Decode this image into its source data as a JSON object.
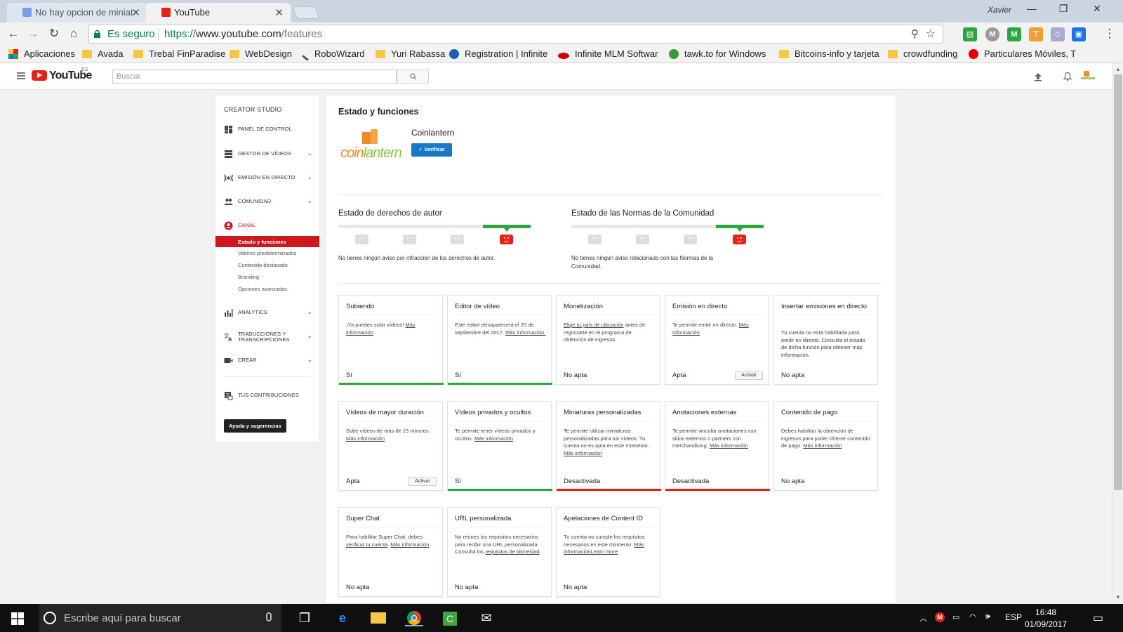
{
  "browser": {
    "tabs": [
      {
        "title": "No hay opcion de miniat",
        "active": false
      },
      {
        "title": "YouTube",
        "active": true
      }
    ],
    "user": "Xavier",
    "secure_label": "Es seguro",
    "url_proto": "https://",
    "url_host": "www.youtube.com",
    "url_path": "/features",
    "bookmarks": [
      "Aplicaciones",
      "Avada",
      "Trebal FinParadise",
      "WebDesign",
      "RoboWizard",
      "Yuri Rabassa",
      "Registration | Infinite",
      "Infinite MLM Softwar",
      "tawk.to for Windows",
      "Bitcoins-info y tarjeta",
      "crowdfunding",
      "Particulares Móviles, T"
    ]
  },
  "header": {
    "region": "ES",
    "search_placeholder": "Buscar"
  },
  "sidebar": {
    "heading": "CREATOR STUDIO",
    "items": [
      {
        "label": "PANEL DE CONTROL"
      },
      {
        "label": "GESTOR DE VÍDEOS"
      },
      {
        "label": "EMISIÓN EN DIRECTO"
      },
      {
        "label": "COMUNIDAD"
      },
      {
        "label": "CANAL"
      }
    ],
    "canal_subitems": [
      "Estado y funciones",
      "Valores predeterminados",
      "Contenido destacado",
      "Branding",
      "Opciones avanzadas"
    ],
    "items2": [
      {
        "label": "ANALYTICS"
      },
      {
        "label": "TRADUCCIONES Y TRANSCRIPCIONES"
      },
      {
        "label": "CREAR"
      }
    ],
    "contrib": "TUS CONTRIBUCIONES",
    "help": "Ayuda y sugerencias"
  },
  "main": {
    "title": "Estado y funciones",
    "channel_name": "Coinlantern",
    "verify": "Verificar",
    "copyright_title": "Estado de derechos de autor",
    "copyright_text": "No tienes ningún aviso por infracción de los derechos de autor.",
    "community_title": "Estado de las Normas de la Comunidad",
    "community_text": "No tienes ningún aviso relacionado con las Normas de la Comunidad."
  },
  "cards": [
    {
      "title": "Subiendo",
      "desc": "¡Ya puedes subir vídeos!",
      "link": "Más información",
      "status": "Sí",
      "bar": "#2ba640"
    },
    {
      "title": "Editor de vídeo",
      "desc": "Este editor desaparecerá el 20 de septiembre del 2017.",
      "link": "Más información.",
      "status": "Sí",
      "bar": "#2ba640"
    },
    {
      "title": "Monetización",
      "link_pre": "Elige tu país de ubicación",
      "desc": " antes de registrarte en el programa de obtención de ingresos.",
      "status": "No apta",
      "bar": ""
    },
    {
      "title": "Emisión en directo",
      "desc": "Te permite emitir en directo.",
      "link": "Más información",
      "status": "Apta",
      "button": "Activar",
      "bar": ""
    },
    {
      "title": "Insertar emisiones en directo",
      "desc": "Tu cuenta no está habilitada para emitir en directo. Consulta el estado de dicha función para obtener más información.",
      "status": "No apta",
      "bar": ""
    },
    {
      "title": "Vídeos de mayor duración",
      "desc": "Sube vídeos de más de 15 minutos.",
      "link": "Más información",
      "status": "Apta",
      "button": "Activar",
      "bar": ""
    },
    {
      "title": "Vídeos privados y ocultos",
      "desc": "Te permite tener vídeos privados y ocultos.",
      "link": "Más información",
      "status": "Sí",
      "bar": "#2ba640"
    },
    {
      "title": "Miniaturas personalizadas",
      "desc": "Te permite utilizar miniaturas personalizadas para tus vídeos. Tu cuenta no es apta en este momento.",
      "link": "Más información",
      "status": "Desactivada",
      "bar": "#e62117"
    },
    {
      "title": "Anotaciones externas",
      "desc": "Te permite vincular anotaciones con sitios externos o partners con merchandising.",
      "link": "Más información",
      "status": "Desactivada",
      "bar": "#e62117"
    },
    {
      "title": "Contenido de pago",
      "desc": "Debes habilitar la obtención de ingresos para poder ofrecer contenido de pago.",
      "link": "Más información",
      "status": "No apta",
      "bar": ""
    },
    {
      "title": "Super Chat",
      "desc": "Para habilitar Super Chat, debes ",
      "link_mid": "verificar tu cuenta",
      "link": "Más información",
      "status": "No apta",
      "bar": ""
    },
    {
      "title": "URL personalizada",
      "desc": "No reúnes los requisitos necesarios para recibir una URL personalizada. Consulta los ",
      "link": "requisitos de idoneidad",
      "status": "No apta",
      "bar": ""
    },
    {
      "title": "Apelaciones de Content ID",
      "desc": "Tu cuenta no cumple los requisitos necesarios en este momento.",
      "link": "Más informaciónLearn more",
      "status": "No apta",
      "bar": ""
    }
  ],
  "taskbar": {
    "search_placeholder": "Escribe aquí para buscar",
    "lang": "ESP",
    "time": "16:48",
    "date": "01/09/2017"
  }
}
